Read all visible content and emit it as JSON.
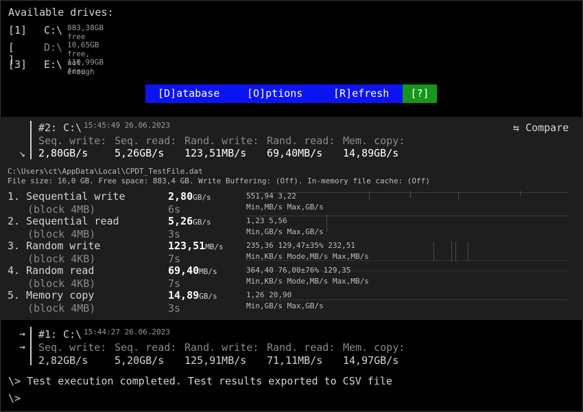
{
  "drives": {
    "title": "Available drives:",
    "items": [
      {
        "key": "[1]",
        "name": "C:\\",
        "free": "883,38GB free"
      },
      {
        "key": "[ ]",
        "name": "D:\\",
        "free": "10,65GB free, not enough"
      },
      {
        "key": "[3]",
        "name": "E:\\",
        "free": "110,99GB free"
      }
    ]
  },
  "menu": {
    "database": "[D]atabase",
    "options": "[O]ptions",
    "refresh": "[R]efresh",
    "help": "[?]",
    "colors": {
      "menu_bg": "#0b14f0",
      "help_bg": "#17961a"
    }
  },
  "current": {
    "title": "#2: C:\\",
    "time": "15:45:49 26.06.2023",
    "compare_icon": "⇆",
    "compare": "Compare",
    "arrow": "↘",
    "headers": [
      "Seq. write:",
      "Seq. read:",
      "Rand. write:",
      "Rand. read:",
      "Mem. copy:"
    ],
    "values": [
      "2,80GB/s",
      "5,26GB/s",
      "123,51MB/s",
      "69,40MB/s",
      "14,89GB/s"
    ]
  },
  "file_info": {
    "path": "C:\\Users\\ct\\AppData\\Local\\CPDT_TestFile.dat",
    "details": "File size: 16,0 GB. Free space: 883,4 GB. Write Buffering: (Off). In-memory file cache: (Off)"
  },
  "tests": [
    {
      "label": "1. Sequential write",
      "block": "(block 4MB)",
      "value": "2,80",
      "unit": "GB/s",
      "time": "6s",
      "stat_values": "551,94   3,22",
      "stat_units": "Min,MB/s Max,GB/s"
    },
    {
      "label": "2. Sequential read",
      "block": "(block 4MB)",
      "value": "5,26",
      "unit": "GB/s",
      "time": "3s",
      "stat_values": "1,23     5,56",
      "stat_units": "Min,GB/s Max,GB/s"
    },
    {
      "label": "3. Random write",
      "block": "(block 4KB)",
      "value": "123,51",
      "unit": "MB/s",
      "time": "7s",
      "stat_values": "235,36   129,47±35% 232,51",
      "stat_units": "Min,KB/s Mode,MB/s  Max,MB/s"
    },
    {
      "label": "4. Random read",
      "block": "(block 4KB)",
      "value": "69,40",
      "unit": "MB/s",
      "time": "7s",
      "stat_values": "364,40   76,00±76% 129,35",
      "stat_units": "Min,KB/s Mode,MB/s Max,MB/s"
    },
    {
      "label": "5. Memory copy",
      "block": "(block 4MB)",
      "value": "14,89",
      "unit": "GB/s",
      "time": "3s",
      "stat_values": "1,26     20,90",
      "stat_units": "Min,GB/s Max,GB/s"
    }
  ],
  "previous": {
    "title": "#1: C:\\",
    "time": "15:44:27 26.06.2023",
    "arrow": "→",
    "headers": [
      "Seq. write:",
      "Seq. read:",
      "Rand. write:",
      "Rand. read:",
      "Mem. copy:"
    ],
    "values": [
      "2,82GB/s",
      "5,20GB/s",
      "125,91MB/s",
      "71,11MB/s",
      "14,97GB/s"
    ]
  },
  "console": {
    "line1": "\\> Test execution completed. Test results exported to CSV file",
    "prompt": "\\>"
  }
}
